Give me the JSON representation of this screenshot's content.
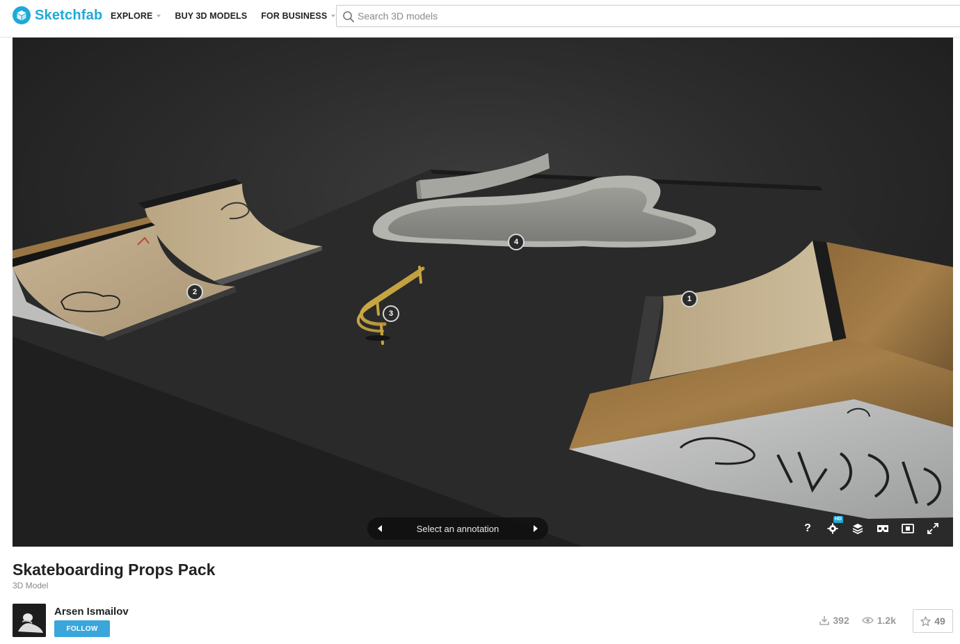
{
  "header": {
    "brand": "Sketchfab",
    "nav": [
      {
        "label": "EXPLORE",
        "has_caret": true
      },
      {
        "label": "BUY 3D MODELS",
        "has_caret": false
      },
      {
        "label": "FOR BUSINESS",
        "has_caret": true
      }
    ],
    "search_placeholder": "Search 3D models"
  },
  "viewer": {
    "annotations": [
      {
        "number": "1"
      },
      {
        "number": "2"
      },
      {
        "number": "3"
      },
      {
        "number": "4"
      }
    ],
    "annotation_bar_label": "Select an annotation",
    "controls": [
      "help-icon",
      "settings-icon",
      "layers-icon",
      "vr-icon",
      "screen-icon",
      "fullscreen-icon"
    ],
    "hd_badge": "HD",
    "help_glyph": "?"
  },
  "model": {
    "title": "Skateboarding Props Pack",
    "type": "3D Model"
  },
  "author": {
    "name": "Arsen Ismailov",
    "follow_label": "FOLLOW"
  },
  "stats": {
    "downloads": "392",
    "views": "1.2k",
    "likes": "49"
  },
  "colors": {
    "brand": "#1caad9",
    "follow": "#3aa6db"
  }
}
